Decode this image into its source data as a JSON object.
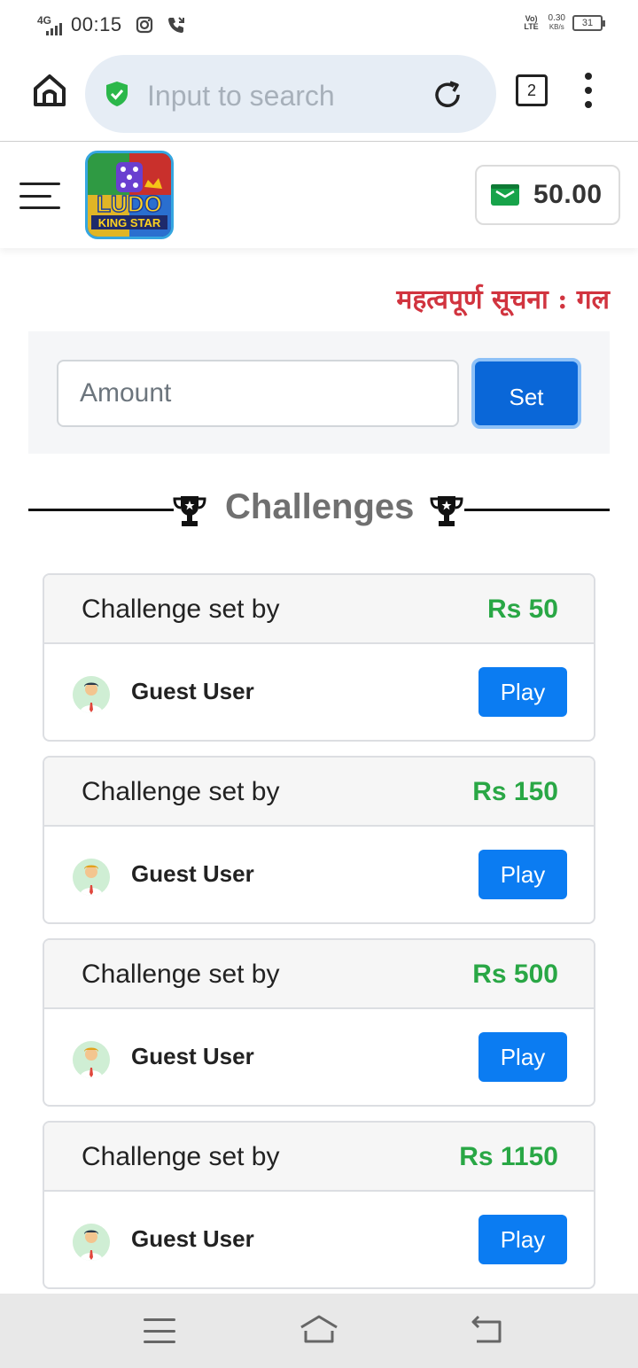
{
  "status_bar": {
    "network": "4G",
    "time": "00:15",
    "volte": "Vo) LTE",
    "speed_value": "0.30",
    "speed_unit": "KB/s",
    "battery": "31"
  },
  "browser": {
    "search_placeholder": "Input to search",
    "tab_count": "2"
  },
  "header": {
    "logo_text": "LUDO KING STAR",
    "wallet_amount": "50.00",
    "wallet_color": "#17a34a"
  },
  "notice": {
    "text": "महत्वपूर्ण सूचना : गल"
  },
  "amount_form": {
    "placeholder": "Amount",
    "set_label": "Set"
  },
  "challenges": {
    "title": "Challenges",
    "items": [
      {
        "title": "Challenge set by",
        "amount": "Rs 50",
        "user": "Guest User",
        "play_label": "Play"
      },
      {
        "title": "Challenge set by",
        "amount": "Rs 150",
        "user": "Guest User",
        "play_label": "Play"
      },
      {
        "title": "Challenge set by",
        "amount": "Rs 500",
        "user": "Guest User",
        "play_label": "Play"
      },
      {
        "title": "Challenge set by",
        "amount": "Rs 1150",
        "user": "Guest User",
        "play_label": "Play"
      }
    ]
  },
  "colors": {
    "accent_blue": "#0b7cf2",
    "amount_green": "#29a745",
    "notice_red": "#d1343f"
  }
}
